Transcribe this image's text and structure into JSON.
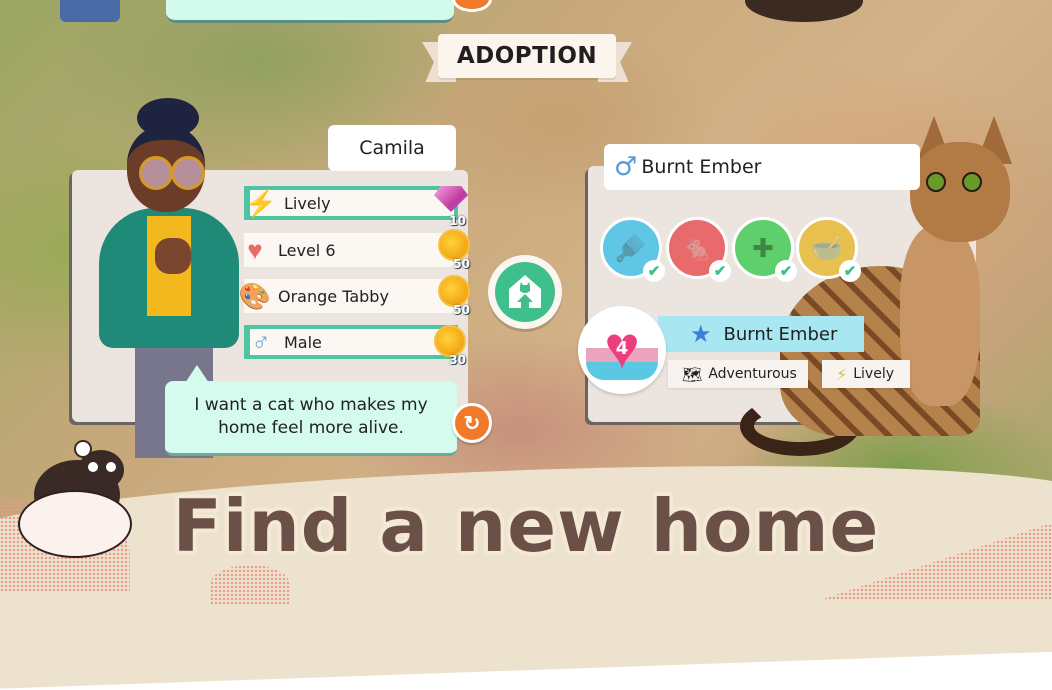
{
  "banner": {
    "title": "ADOPTION"
  },
  "owner": {
    "name": "Camila",
    "traits": [
      {
        "icon": "lightning-icon",
        "glyph": "⚡",
        "label": "Lively",
        "reward_type": "gem",
        "reward": "10",
        "framed": true
      },
      {
        "icon": "heart-icon",
        "glyph": "♥",
        "label": "Level 6",
        "reward_type": "coin",
        "reward": "50",
        "framed": false
      },
      {
        "icon": "palette-icon",
        "glyph": "🎨",
        "label": "Orange Tabby",
        "reward_type": "coin",
        "reward": "50",
        "framed": false
      },
      {
        "icon": "male-icon",
        "glyph": "♂",
        "label": "Male",
        "reward_type": "coin",
        "reward": "30",
        "framed": true
      }
    ],
    "quote": "I want a cat who makes my home feel more alive.",
    "refresh_glyph": "↻"
  },
  "adopt_button": {
    "icon": "cat-house-icon"
  },
  "cat": {
    "gender_glyph": "♂",
    "name": "Burnt Ember",
    "needs": [
      {
        "icon": "brush-icon",
        "glyph": "🪮",
        "color": "#5fc6e6",
        "done": true
      },
      {
        "icon": "toy-mouse-icon",
        "glyph": "🐁",
        "color": "#e86a6a",
        "done": true
      },
      {
        "icon": "first-aid-kit-icon",
        "glyph": "✚",
        "color": "#5fcf6e",
        "done": true
      },
      {
        "icon": "food-bowl-icon",
        "glyph": "🥣",
        "color": "#e8c050",
        "done": true
      }
    ],
    "check_glyph": "✔",
    "bond_level": "4",
    "title_name": "Burnt Ember",
    "star_glyph": "★",
    "personalities": [
      {
        "icon": "map-icon",
        "glyph": "🗺",
        "label": "Adventurous"
      },
      {
        "icon": "lightning-icon",
        "glyph": "⚡",
        "label": "Lively"
      }
    ]
  },
  "headline": "Find a new home",
  "colors": {
    "trait_frame": "#4fc4a0",
    "speech_bg": "#d4fbee",
    "refresh": "#f07a2a",
    "adopt_green": "#3fbf8c",
    "headline_text": "#6b5048"
  }
}
